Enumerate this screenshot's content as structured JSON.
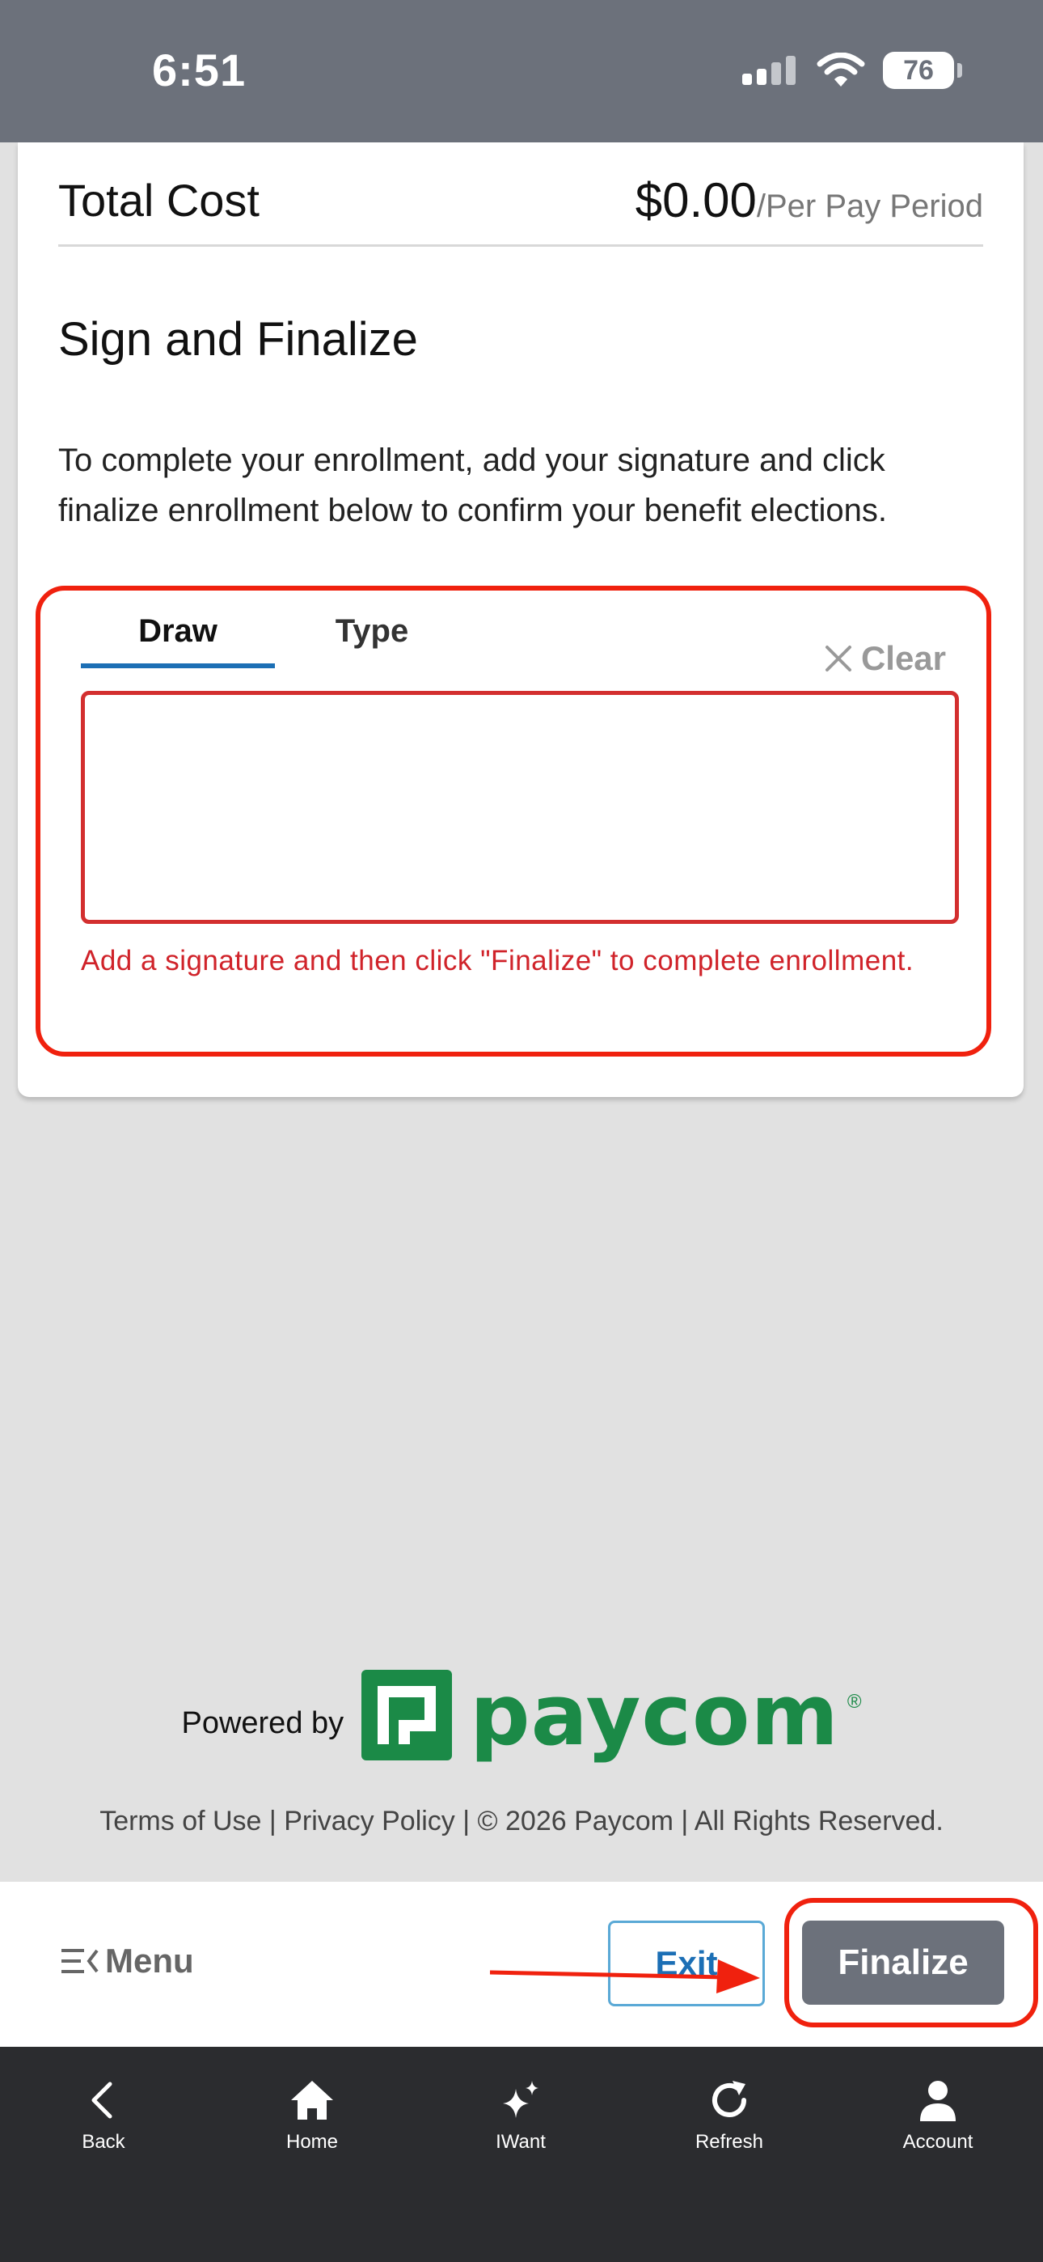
{
  "status_bar": {
    "time": "6:51",
    "battery": "76"
  },
  "summary": {
    "total_label": "Total Cost",
    "total_amount": "$0.00",
    "total_period": "/Per Pay Period"
  },
  "sign": {
    "title": "Sign and Finalize",
    "description": "To complete your enrollment, add your signature and click finalize enrollment below to confirm your benefit elections.",
    "tabs": [
      {
        "label": "Draw",
        "active": true
      },
      {
        "label": "Type",
        "active": false
      }
    ],
    "clear_label": "Clear",
    "error_message": "Add a signature and then click \"Finalize\" to complete enrollment."
  },
  "branding": {
    "powered_by": "Powered by",
    "brand_name": "paycom",
    "brand_color": "#1b8a47"
  },
  "footer": {
    "links": "Terms of Use | Privacy Policy | © 2026 Paycom | All Rights Reserved."
  },
  "actions": {
    "menu_label": "Menu",
    "exit_label": "Exit",
    "finalize_label": "Finalize"
  },
  "bottom_nav": [
    {
      "label": "Back",
      "icon": "chevron-left-icon"
    },
    {
      "label": "Home",
      "icon": "home-icon"
    },
    {
      "label": "IWant",
      "icon": "sparkle-icon"
    },
    {
      "label": "Refresh",
      "icon": "refresh-icon"
    },
    {
      "label": "Account",
      "icon": "person-icon"
    }
  ],
  "colors": {
    "status_bar": "#6c717b",
    "annotation_red": "#f0210e",
    "error_red": "#d0232a",
    "accent_blue": "#1c6fb5"
  }
}
